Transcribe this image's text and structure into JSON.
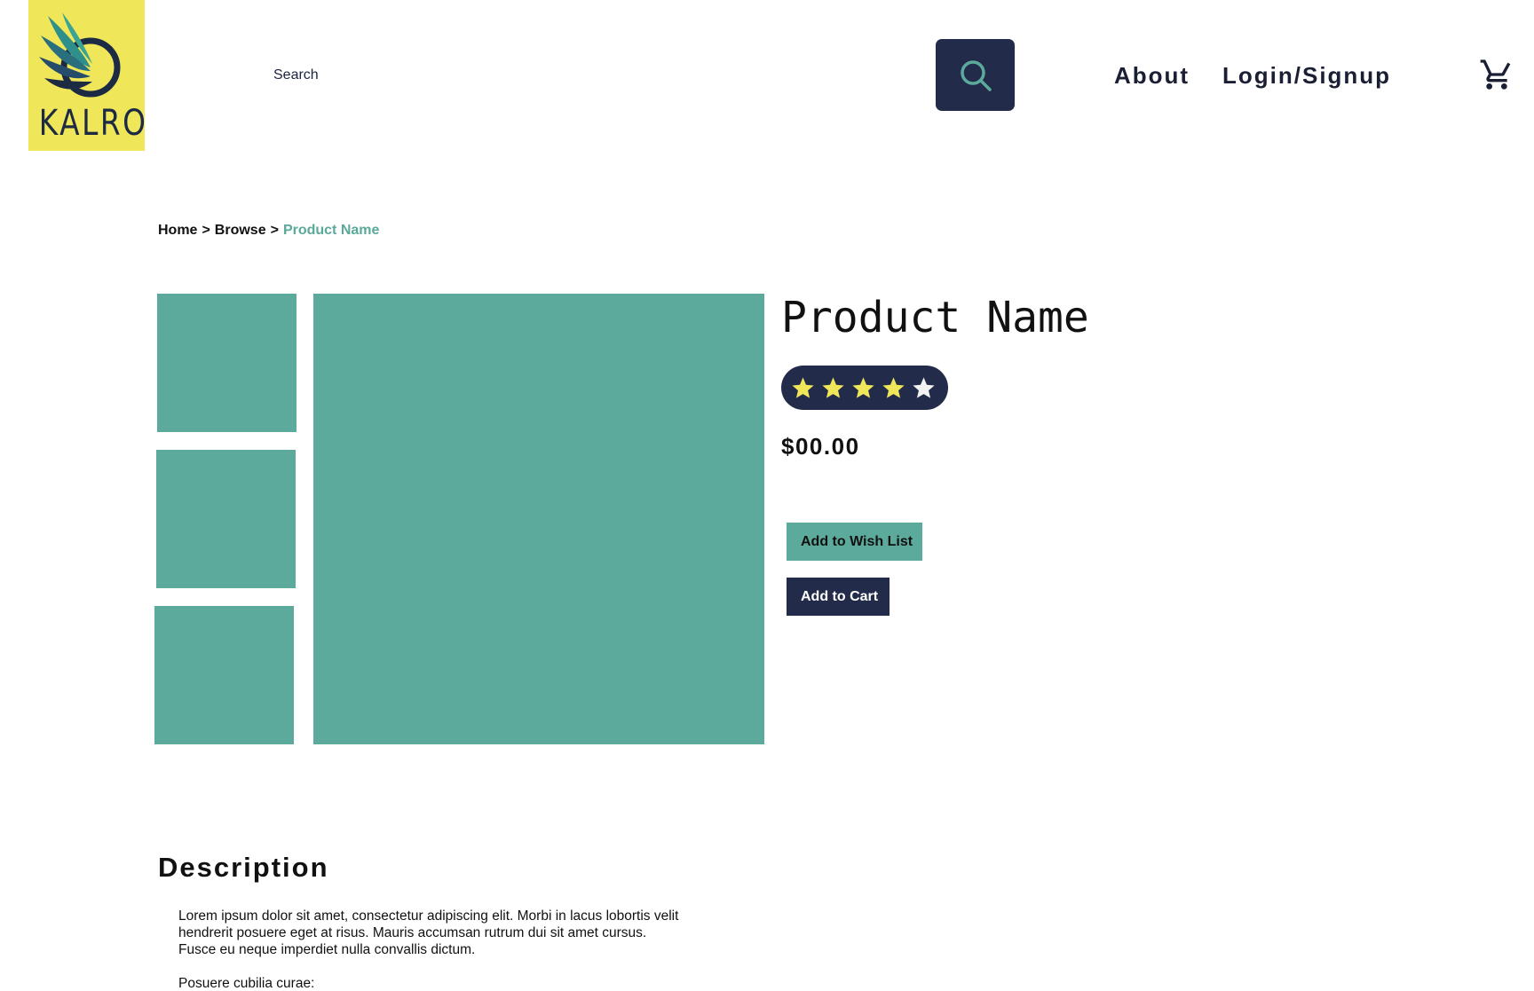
{
  "brand": {
    "name": "KALRO",
    "logo_bg": "#f0e65a",
    "logo_fg": "#1d2a44"
  },
  "header": {
    "search_placeholder": "Search",
    "nav": {
      "about": "About",
      "login": "Login/Signup"
    },
    "icons": {
      "search": "search-icon",
      "cart": "cart-icon"
    }
  },
  "breadcrumb": {
    "items": [
      "Home",
      "Browse"
    ],
    "current": "Product Name",
    "separator": ">"
  },
  "product": {
    "name": "Product Name",
    "rating": 4,
    "rating_max": 5,
    "price": "$00.00",
    "actions": {
      "wishlist": "Add to Wish List",
      "cart": "Add to Cart"
    }
  },
  "gallery": {
    "thumbnail_count": 3
  },
  "description": {
    "heading": "Description",
    "paragraphs": [
      "Lorem ipsum dolor sit amet, consectetur adipiscing elit. Morbi in lacus lobortis velit hendrerit posuere eget at risus. Mauris accumsan rutrum dui sit amet cursus. Fusce eu neque imperdiet nulla convallis dictum.",
      "Posuere cubilia curae:"
    ]
  },
  "colors": {
    "accent": "#5caa9b",
    "navy": "#232b4a",
    "star_filled": "#f0e65a",
    "star_empty": "#f2f2f2"
  }
}
